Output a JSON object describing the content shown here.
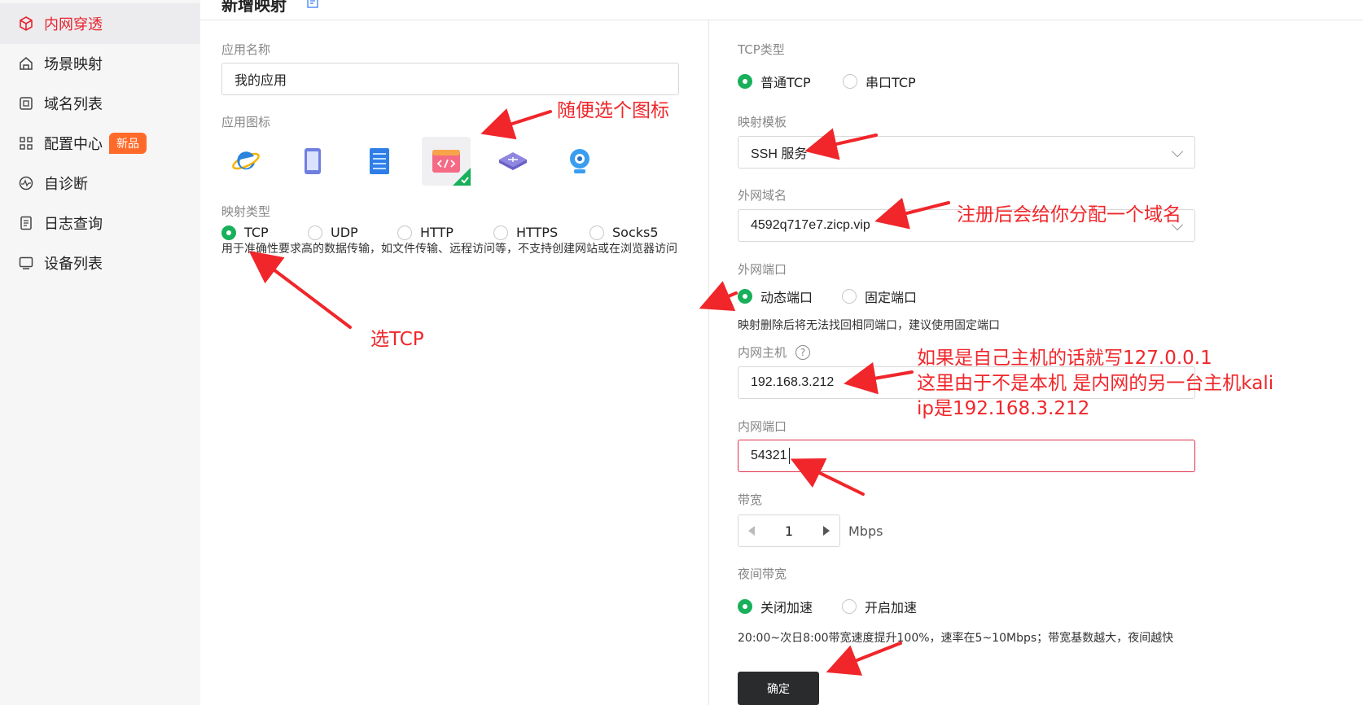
{
  "sidebar": {
    "items": [
      {
        "label": "内网穿透",
        "icon": "cube-icon",
        "active": true
      },
      {
        "label": "场景映射",
        "icon": "house-icon"
      },
      {
        "label": "域名列表",
        "icon": "domain-icon"
      },
      {
        "label": "配置中心",
        "icon": "grid-icon",
        "badge": "新品"
      },
      {
        "label": "自诊断",
        "icon": "pulse-icon"
      },
      {
        "label": "日志查询",
        "icon": "document-icon"
      },
      {
        "label": "设备列表",
        "icon": "monitor-icon"
      }
    ]
  },
  "header": {
    "title": "新增映射"
  },
  "left_form": {
    "app_name": {
      "label": "应用名称",
      "value": "我的应用"
    },
    "app_icon": {
      "label": "应用图标",
      "icons": [
        "ie-browser-icon",
        "tablet-icon",
        "server-icon",
        "code-window-icon",
        "router-icon",
        "webcam-icon"
      ],
      "selected_index": 3
    },
    "mapping_type": {
      "label": "映射类型",
      "options": [
        "TCP",
        "UDP",
        "HTTP",
        "HTTPS",
        "Socks5"
      ],
      "selected": "TCP",
      "help": "用于准确性要求高的数据传输，如文件传输、远程访问等，不支持创建网站或在浏览器访问"
    }
  },
  "right_form": {
    "tcp_type": {
      "label": "TCP类型",
      "options": [
        "普通TCP",
        "串口TCP"
      ],
      "selected": "普通TCP"
    },
    "template": {
      "label": "映射模板",
      "value": "SSH 服务"
    },
    "domain": {
      "label": "外网域名",
      "value": "4592q717e7.zicp.vip"
    },
    "external_port": {
      "label": "外网端口",
      "options": [
        "动态端口",
        "固定端口"
      ],
      "selected": "动态端口",
      "help": "映射删除后将无法找回相同端口，建议使用固定端口"
    },
    "internal_host": {
      "label": "内网主机",
      "help_icon": "?",
      "value": "192.168.3.212"
    },
    "internal_port": {
      "label": "内网端口",
      "value": "54321"
    },
    "bandwidth": {
      "label": "带宽",
      "value": "1",
      "unit": "Mbps"
    },
    "night_bandwidth": {
      "label": "夜间带宽",
      "options": [
        "关闭加速",
        "开启加速"
      ],
      "selected": "关闭加速",
      "help": "20:00~次日8:00带宽速度提升100%，速率在5~10Mbps；带宽基数越大，夜间越快"
    },
    "confirm": "确定"
  },
  "annotations": {
    "pick_icon": "随便选个图标",
    "pick_tcp": "选TCP",
    "domain_note": "注册后会给你分配一个域名",
    "host_note_1": "如果是自己主机的话就写127.0.0.1",
    "host_note_2": "这里由于不是本机 是内网的另一台主机kali",
    "host_note_3": "ip是192.168.3.212"
  },
  "colors": {
    "accent_red": "#e8232f",
    "radio_green": "#18b05a",
    "badge_orange": "#ff6a2a",
    "annotation_red": "#f0262a"
  }
}
